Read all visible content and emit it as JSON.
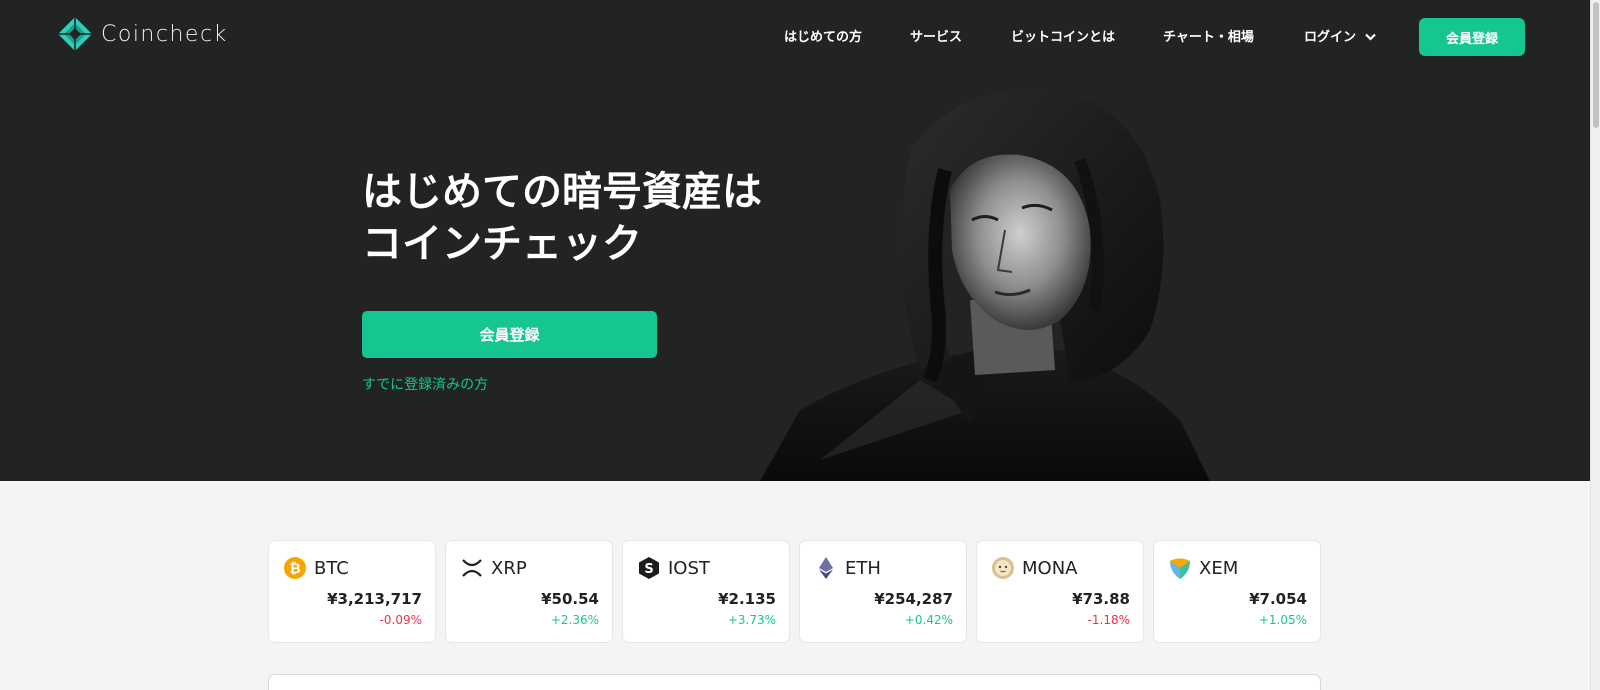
{
  "brand": {
    "name": "Coincheck",
    "accent": "#16c690",
    "dark_bg": "#222323"
  },
  "nav": {
    "links": [
      {
        "label": "はじめての方"
      },
      {
        "label": "サービス"
      },
      {
        "label": "ビットコインとは"
      },
      {
        "label": "チャート・相場"
      },
      {
        "label": "ログイン"
      }
    ],
    "signup_label": "会員登録"
  },
  "hero": {
    "headline_line1": "はじめての暗号資産は",
    "headline_line2": "コインチェック",
    "signup_label": "会員登録",
    "login_link": "すでに登録済みの方"
  },
  "coins": [
    {
      "symbol": "BTC",
      "icon": "bitcoin-icon",
      "price": "¥3,213,717",
      "change": "-0.09%",
      "direction": "down"
    },
    {
      "symbol": "XRP",
      "icon": "xrp-icon",
      "price": "¥50.54",
      "change": "+2.36%",
      "direction": "up"
    },
    {
      "symbol": "IOST",
      "icon": "iost-icon",
      "price": "¥2.135",
      "change": "+3.73%",
      "direction": "up"
    },
    {
      "symbol": "ETH",
      "icon": "ethereum-icon",
      "price": "¥254,287",
      "change": "+0.42%",
      "direction": "up"
    },
    {
      "symbol": "MONA",
      "icon": "monacoin-icon",
      "price": "¥73.88",
      "change": "-1.18%",
      "direction": "down"
    },
    {
      "symbol": "XEM",
      "icon": "nem-icon",
      "price": "¥7.054",
      "change": "+1.05%",
      "direction": "up"
    }
  ]
}
